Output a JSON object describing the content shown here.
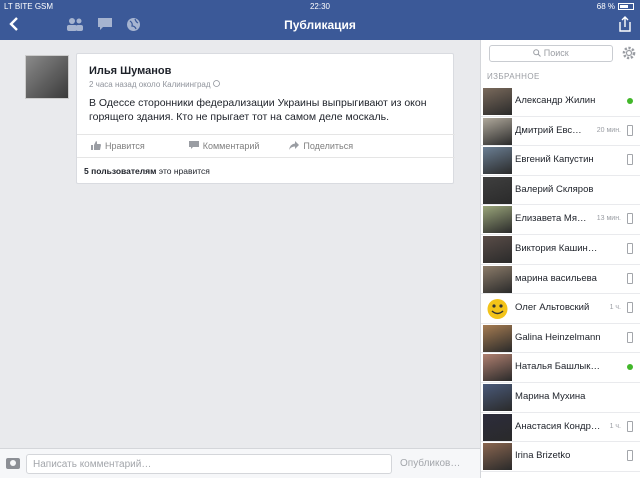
{
  "status": {
    "carrier": "LT BITE GSM",
    "time": "22:30",
    "battery": "68 %",
    "battery_level": 0.68
  },
  "header": {
    "title": "Публикация"
  },
  "post": {
    "author": "Илья Шуманов",
    "meta": "2 часа назад около Калининград",
    "text": "В Одессе сторонники федерализации Украины выпрыгивают из окон горящего здания. Кто не прыгает тот на самом деле москаль.",
    "actions": {
      "like": "Нравится",
      "comment": "Комментарий",
      "share": "Поделиться"
    },
    "likes_count": "5 пользователям",
    "likes_suffix": "это нравится"
  },
  "comment_bar": {
    "placeholder": "Написать комментарий…",
    "publish": "Опубликов…"
  },
  "sidebar": {
    "search_placeholder": "Поиск",
    "section_title": "ИЗБРАННОЕ",
    "friends": [
      {
        "name": "Александр Жилин",
        "time": "",
        "status": "online",
        "color": "#7a6a5c"
      },
      {
        "name": "Дмитрий Евс…",
        "time": "20 мин.",
        "status": "mobile",
        "color": "#b0a99c"
      },
      {
        "name": "Евгений Капустин",
        "time": "",
        "status": "mobile",
        "color": "#6b7f94"
      },
      {
        "name": "Валерий Скляров",
        "time": "",
        "status": "none",
        "color": "#3f3f3f"
      },
      {
        "name": "Елизавета Мя…",
        "time": "13 мин.",
        "status": "mobile",
        "color": "#9aa57a"
      },
      {
        "name": "Виктория Кашинская",
        "time": "",
        "status": "mobile",
        "color": "#5a4d48"
      },
      {
        "name": "марина васильева",
        "time": "",
        "status": "mobile",
        "color": "#8c7c6a"
      },
      {
        "name": "Олег Альтовский",
        "time": "1 ч.",
        "status": "mobile",
        "color": "#f3c319"
      },
      {
        "name": "Galina Heinzelmann",
        "time": "",
        "status": "mobile",
        "color": "#a67c52"
      },
      {
        "name": "Наталья Башлыкова",
        "time": "",
        "status": "online",
        "color": "#b08070"
      },
      {
        "name": "Марина Мухина",
        "time": "",
        "status": "none",
        "color": "#4a5a7a"
      },
      {
        "name": "Анастасия Кондрат…",
        "time": "1 ч.",
        "status": "mobile",
        "color": "#2c2c3c"
      },
      {
        "name": "Irina Brizetko",
        "time": "",
        "status": "mobile",
        "color": "#8a6650"
      }
    ]
  }
}
